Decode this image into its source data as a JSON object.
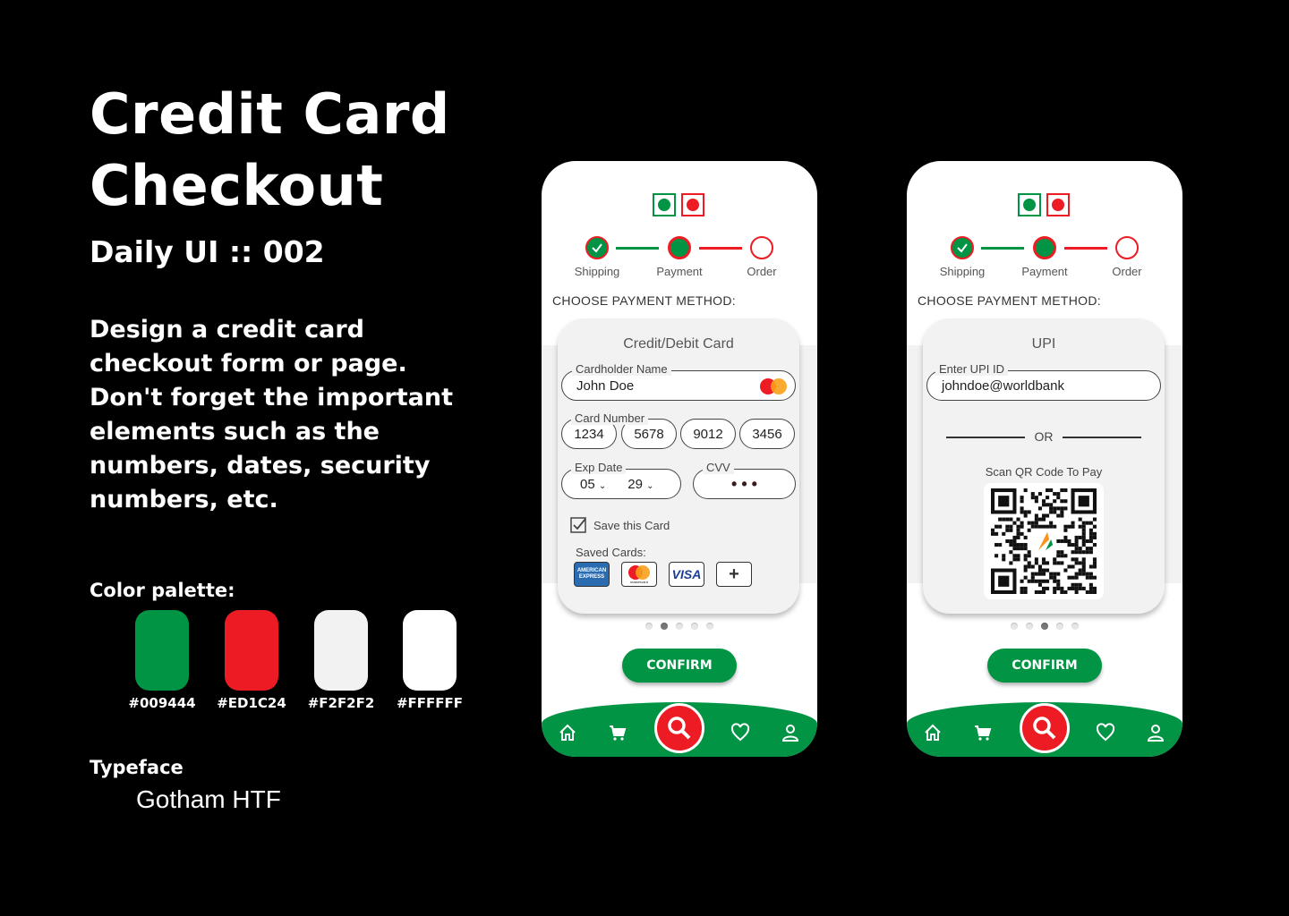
{
  "title_line1": "Credit Card",
  "title_line2": "Checkout",
  "subtitle": "Daily UI :: 002",
  "description": "Design a credit card checkout form or page. Don't forget the important elements such as the numbers, dates, security numbers, etc.",
  "palette": {
    "label": "Color palette:",
    "colors": [
      {
        "hex": "#009444",
        "label": "#009444"
      },
      {
        "hex": "#ED1C24",
        "label": "#ED1C24"
      },
      {
        "hex": "#F2F2F2",
        "label": "#F2F2F2"
      },
      {
        "hex": "#FFFFFF",
        "label": "#FFFFFF"
      }
    ]
  },
  "typeface": {
    "label": "Typeface",
    "value": "Gotham HTF"
  },
  "steps": [
    "Shipping",
    "Payment",
    "Order"
  ],
  "choose_label": "CHOOSE PAYMENT METHOD:",
  "card_screen": {
    "panel_title": "Credit/Debit Card",
    "cardholder_label": "Cardholder Name",
    "cardholder_value": "John Doe",
    "card_number_label": "Card Number",
    "card_number": [
      "1234",
      "5678",
      "9012",
      "3456"
    ],
    "exp_label": "Exp Date",
    "exp_month": "05",
    "exp_year": "29",
    "cvv_label": "CVV",
    "cvv_value": "• • •",
    "save_label": "Save this Card",
    "save_checked": true,
    "saved_cards_label": "Saved Cards:",
    "saved_cards": [
      "amex-icon",
      "mastercard-icon",
      "visa-icon",
      "add-card-icon"
    ],
    "amex_text": "AMERICAN EXPRESS",
    "visa_text": "VISA",
    "mastercard_text": "mastercard",
    "active_dot": 1,
    "confirm": "CONFIRM"
  },
  "upi_screen": {
    "panel_title": "UPI",
    "upi_label": "Enter UPI ID",
    "upi_value": "johndoe@worldbank",
    "or_text": "OR",
    "scan_label": "Scan QR Code To Pay",
    "active_dot": 2,
    "confirm": "CONFIRM"
  },
  "nav_items": [
    "home-icon",
    "cart-icon",
    "search-icon",
    "heart-icon",
    "profile-icon"
  ],
  "colors": {
    "green": "#009444",
    "red": "#ED1C24",
    "grey": "#F2F2F2",
    "white": "#FFFFFF"
  }
}
